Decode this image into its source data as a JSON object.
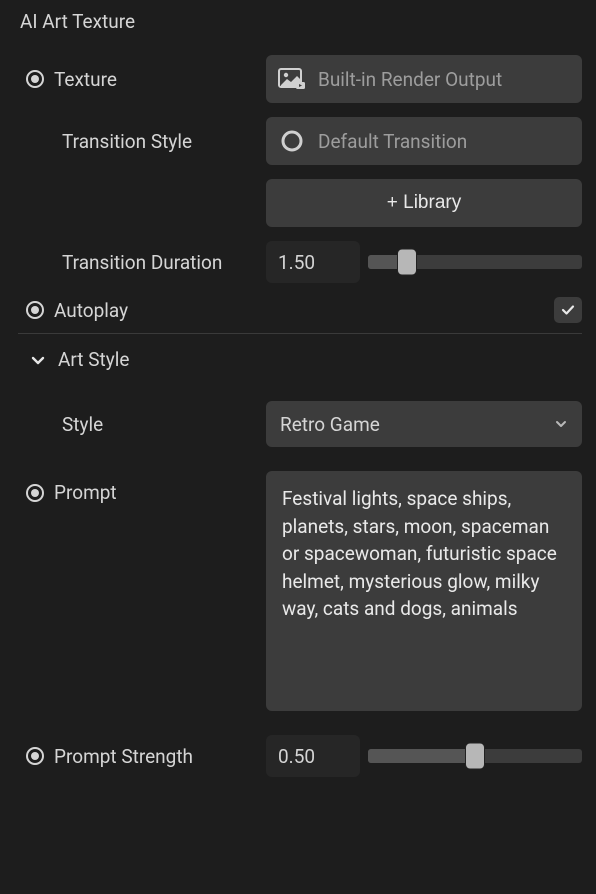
{
  "panel": {
    "title": "AI Art Texture"
  },
  "texture": {
    "label": "Texture",
    "value": "Built-in Render Output"
  },
  "transitionStyle": {
    "label": "Transition Style",
    "value": "Default Transition"
  },
  "library": {
    "label": "+ Library"
  },
  "transitionDuration": {
    "label": "Transition Duration",
    "value": "1.50",
    "slider_percent": 18
  },
  "autoplay": {
    "label": "Autoplay",
    "checked": true
  },
  "artStyleSection": {
    "title": "Art Style"
  },
  "style": {
    "label": "Style",
    "value": "Retro Game"
  },
  "prompt": {
    "label": "Prompt",
    "value": "Festival lights, space ships, planets, stars, moon, spaceman or spacewoman, futuristic space helmet, mysterious glow, milky way, cats and dogs, animals"
  },
  "promptStrength": {
    "label": "Prompt Strength",
    "value": "0.50",
    "slider_percent": 50
  }
}
